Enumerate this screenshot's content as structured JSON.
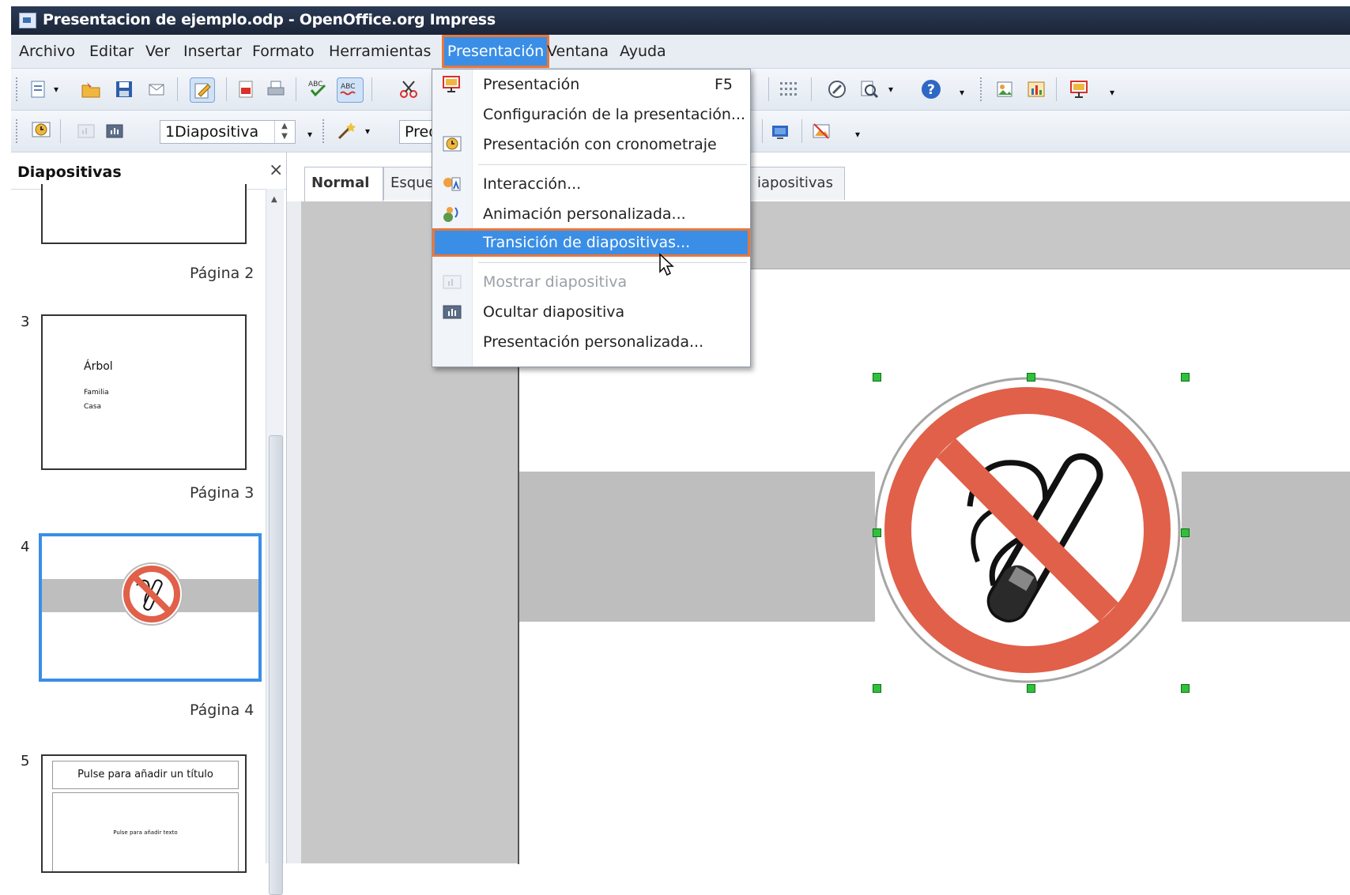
{
  "window": {
    "title": "Presentacion de ejemplo.odp - OpenOffice.org Impress"
  },
  "menubar": {
    "items": [
      "Archivo",
      "Editar",
      "Ver",
      "Insertar",
      "Formato",
      "Herramientas",
      "Presentación",
      "Ventana",
      "Ayuda"
    ]
  },
  "toolbar2": {
    "slide_layout_value": "1Diapositiva",
    "design_value": "Prede"
  },
  "slides_pane": {
    "title": "Diapositivas",
    "close": "×",
    "slides": [
      {
        "number": "",
        "page_label": "Página 2"
      },
      {
        "number": "3",
        "page_label": "Página 3",
        "text_title": "Árbol",
        "text_items": [
          "Familia",
          "Casa"
        ]
      },
      {
        "number": "4",
        "page_label": "Página 4"
      },
      {
        "number": "5",
        "page_label": "",
        "placeholder_title": "Pulse para añadir un título",
        "placeholder_text": "Pulse para añadir texto"
      }
    ]
  },
  "view_tabs": {
    "normal": "Normal",
    "outline": "Esquem",
    "slide_sorter": "iapositivas"
  },
  "dropdown": {
    "items": [
      {
        "label": "Presentación",
        "shortcut": "F5",
        "icon": "presentation-icon",
        "state": "normal"
      },
      {
        "label": "Configuración de la presentación...",
        "shortcut": "",
        "icon": "",
        "state": "normal"
      },
      {
        "label": "Presentación con cronometraje",
        "shortcut": "",
        "icon": "rehearse-timings-icon",
        "state": "normal"
      },
      {
        "label": "Interacción...",
        "shortcut": "",
        "icon": "interaction-icon",
        "state": "normal"
      },
      {
        "label": "Animación personalizada...",
        "shortcut": "",
        "icon": "custom-animation-icon",
        "state": "normal"
      },
      {
        "label": "Transición de diapositivas...",
        "shortcut": "",
        "icon": "",
        "state": "highlighted"
      },
      {
        "label": "Mostrar diapositiva",
        "shortcut": "",
        "icon": "show-slide-icon",
        "state": "disabled"
      },
      {
        "label": "Ocultar diapositiva",
        "shortcut": "",
        "icon": "hide-slide-icon",
        "state": "normal"
      },
      {
        "label": "Presentación personalizada...",
        "shortcut": "",
        "icon": "",
        "state": "normal"
      }
    ]
  },
  "colors": {
    "highlight": "#3a8ee6",
    "annotation_outline": "#e8773b",
    "no_smoking_red": "#e0604a",
    "selection_handle": "#2fc13a"
  }
}
